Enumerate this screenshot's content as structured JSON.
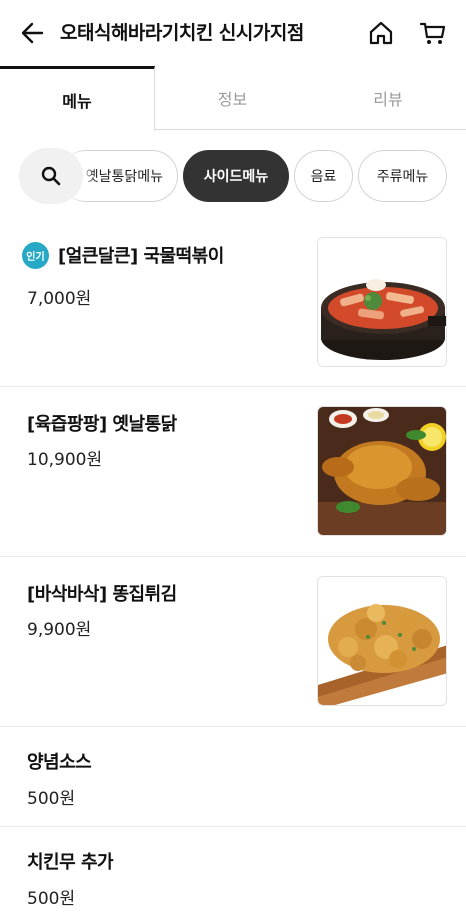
{
  "header": {
    "title": "오태식해바라기치킨 신시가지점",
    "back_icon": "arrow-left-icon",
    "home_icon": "home-icon",
    "cart_icon": "cart-icon"
  },
  "tabs": [
    {
      "label": "메뉴",
      "active": true
    },
    {
      "label": "정보",
      "active": false
    },
    {
      "label": "리뷰",
      "active": false
    }
  ],
  "categories": {
    "search_icon": "search-icon",
    "items": [
      {
        "label": "옛날통닭메뉴",
        "active": false
      },
      {
        "label": "사이드메뉴",
        "active": true
      },
      {
        "label": "음료",
        "active": false
      },
      {
        "label": "주류메뉴",
        "active": false
      }
    ]
  },
  "menu": [
    {
      "badge": "인기",
      "name": "[얼큰달큰] 국물떡볶이",
      "price": "7,000원",
      "image": "tteokbokki"
    },
    {
      "name": "[육즙팡팡] 옛날통닭",
      "price": "10,900원",
      "image": "whole-chicken"
    },
    {
      "name": "[바삭바삭] 똥집튀김",
      "price": "9,900원",
      "image": "fried-gizzard"
    },
    {
      "name": "양념소스",
      "price": "500원"
    },
    {
      "name": "치킨무 추가",
      "price": "500원"
    }
  ],
  "colors": {
    "accent_dark": "#333333",
    "badge": "#27a9c5"
  }
}
